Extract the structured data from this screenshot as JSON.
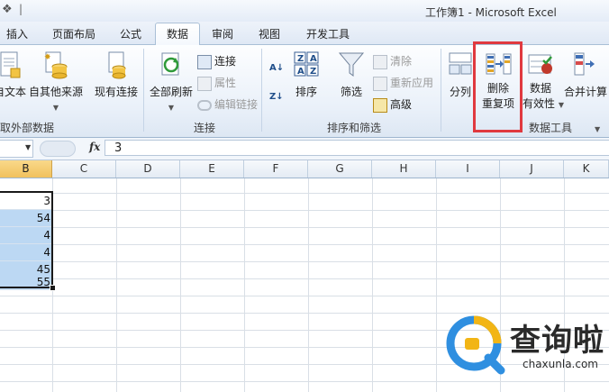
{
  "window": {
    "title": "工作簿1 - Microsoft Excel",
    "qat_separator": "|"
  },
  "tabs": [
    {
      "label": "插入"
    },
    {
      "label": "页面布局"
    },
    {
      "label": "公式"
    },
    {
      "label": "数据"
    },
    {
      "label": "审阅"
    },
    {
      "label": "视图"
    },
    {
      "label": "开发工具"
    }
  ],
  "ribbon": {
    "groups": {
      "external_data": "取外部数据",
      "connections": "连接",
      "sort_filter": "排序和筛选",
      "data_tools": "数据工具"
    },
    "buttons": {
      "from_text": "自文本",
      "from_other": "自其他来源",
      "existing_connections": "现有连接",
      "refresh_all": "全部刷新",
      "connections": "连接",
      "properties": "属性",
      "edit_links": "编辑链接",
      "sort": "排序",
      "filter": "筛选",
      "clear": "清除",
      "reapply": "重新应用",
      "advanced": "高级",
      "text_to_columns": "分列",
      "remove_duplicates_line1": "删除",
      "remove_duplicates_line2": "重复项",
      "data_validation_line1": "数据",
      "data_validation_line2": "有效性",
      "consolidate": "合并计算"
    }
  },
  "formula_bar": {
    "fx": "fx",
    "value": "3"
  },
  "columns": [
    "B",
    "C",
    "D",
    "E",
    "F",
    "G",
    "H",
    "I",
    "J",
    "K"
  ],
  "cells_B": [
    "3",
    "54",
    "4",
    "4",
    "45",
    "55"
  ],
  "watermark": {
    "text": "查询啦",
    "url": "chaxunla.com"
  },
  "colors": {
    "selection_fill": "#bcd8f3",
    "selected_header": "#f1c15d",
    "highlight": "#e0393f"
  }
}
